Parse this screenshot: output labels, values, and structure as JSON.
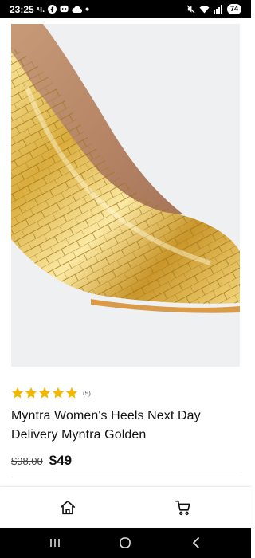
{
  "status_bar": {
    "time": "23:25",
    "carrier_suffix": "ч.",
    "battery": "74",
    "icons": [
      "facebook-icon",
      "messenger-icon",
      "cloud-icon",
      "dot-icon",
      "mute-icon",
      "wifi-icon",
      "signal-icon",
      "battery-icon"
    ]
  },
  "product": {
    "image_alt": "Gold croc-embossed pointed-toe high heel pump",
    "rating": 5,
    "review_count": "(5)",
    "title": "Myntra Women's Heels Next Day Delivery Myntra Golden",
    "old_price": "$98.00",
    "price": "$49"
  },
  "bottom_nav": {
    "items": [
      {
        "icon": "home-icon"
      },
      {
        "icon": "cart-icon"
      }
    ]
  },
  "system_nav": {
    "buttons": [
      "recents-icon",
      "home-circle-icon",
      "back-icon"
    ]
  },
  "colors": {
    "star": "#f2b705",
    "gold_light": "#f7e08a",
    "gold_dark": "#b8860b",
    "image_bg": "#eef0f2"
  }
}
